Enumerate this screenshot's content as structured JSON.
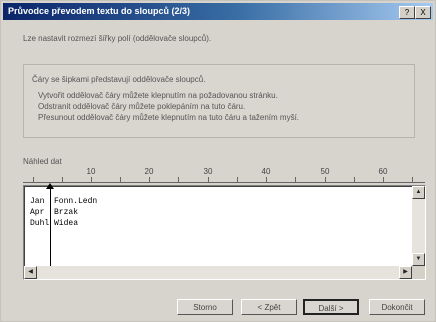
{
  "window": {
    "title": "Průvodce převodem textu do sloupců (2/3)",
    "help_label": "?",
    "close_label": "X"
  },
  "intro_text": "Lze nastavit rozmezí šířky polí (oddělovače sloupců).",
  "info": {
    "heading": "Čáry se šipkami představují oddělovače sloupců.",
    "lines": [
      "Vytvořit oddělovač čáry můžete klepnutím na požadovanou stránku.",
      "Odstranit oddělovač čáry můžete poklepáním na tuto čáru.",
      "Přesunout oddělovač čáry můžete klepnutím na tuto čáru a tažením myší."
    ]
  },
  "preview": {
    "label": "Náhled dat",
    "ruler_numbers": [
      "10",
      "20",
      "30",
      "40",
      "50",
      "60"
    ],
    "rows": [
      "Jan  Fonn.Ledn",
      "Apr  Brzak",
      "Duhl Widea"
    ]
  },
  "buttons": {
    "cancel": "Storno",
    "back": "< Zpět",
    "next": "Další >",
    "finish": "Dokončit"
  }
}
